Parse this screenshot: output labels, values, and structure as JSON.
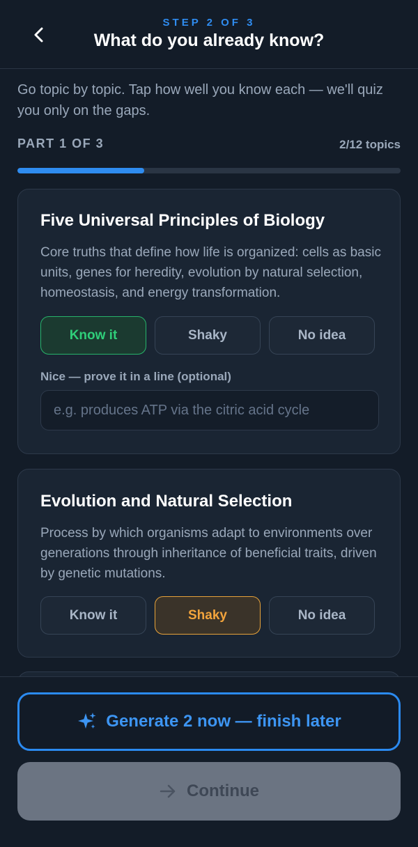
{
  "header": {
    "step": "STEP 2 OF 3",
    "title": "What do you already know?"
  },
  "intro": "Go topic by topic. Tap how well you know each — we'll quiz you only on the gaps.",
  "progress": {
    "part": "PART 1 OF 3",
    "count": "2/12 topics",
    "fraction": 0.33
  },
  "options": {
    "know": "Know it",
    "shaky": "Shaky",
    "none": "No idea"
  },
  "topics": [
    {
      "title": "Five Universal Principles of Biology",
      "description": "Core truths that define how life is organized: cells as basic units, genes for heredity, evolution by natural selection, homeostasis, and energy transformation.",
      "selected": "Know it",
      "prove_label": "Nice — prove it in a line (optional)",
      "prove_placeholder": "e.g. produces ATP via the citric acid cycle",
      "prove_value": ""
    },
    {
      "title": "Evolution and Natural Selection",
      "description": "Process by which organisms adapt to environments over generations through inheritance of beneficial traits, driven by genetic mutations.",
      "selected": "Shaky"
    }
  ],
  "footer": {
    "generate_label": "Generate 2 now — finish later",
    "continue_label": "Continue"
  },
  "icons": {
    "back": "chevron-left-icon",
    "sparkle": "sparkle-icon",
    "arrow": "arrow-right-icon"
  },
  "colors": {
    "accent": "#2f8cf0",
    "known": "#2fcf7a",
    "shaky": "#f2a43c",
    "background": "#131c28",
    "card": "#1a2533"
  }
}
